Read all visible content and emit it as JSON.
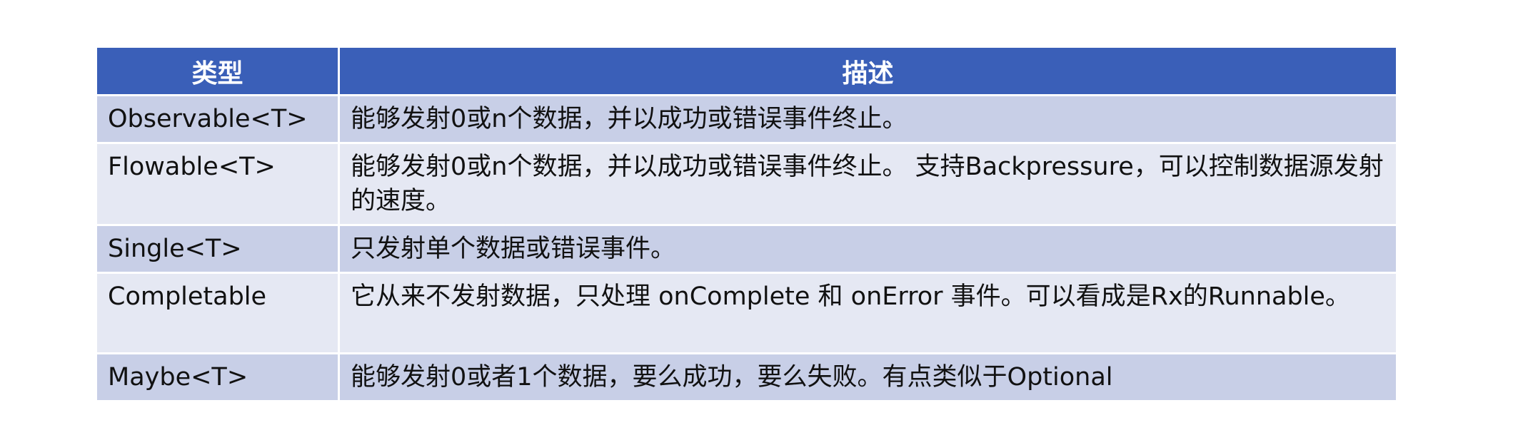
{
  "table": {
    "headers": [
      "类型",
      "描述"
    ],
    "rows": [
      {
        "type": "Observable<T>",
        "desc": "能够发射0或n个数据，并以成功或错误事件终止。"
      },
      {
        "type": "Flowable<T>",
        "desc": "能够发射0或n个数据，并以成功或错误事件终止。 支持Backpressure，可以控制数据源发射的速度。"
      },
      {
        "type": "Single<T>",
        "desc": "只发射单个数据或错误事件。"
      },
      {
        "type": "Completable",
        "desc": "它从来不发射数据，只处理 onComplete 和 onError 事件。可以看成是Rx的Runnable。"
      },
      {
        "type": "Maybe<T>",
        "desc": "能够发射0或者1个数据，要么成功，要么失败。有点类似于Optional"
      }
    ]
  },
  "colors": {
    "header_bg": "#3a5fb8",
    "row_odd_bg": "#c8cfe7",
    "row_even_bg": "#e5e8f3"
  }
}
